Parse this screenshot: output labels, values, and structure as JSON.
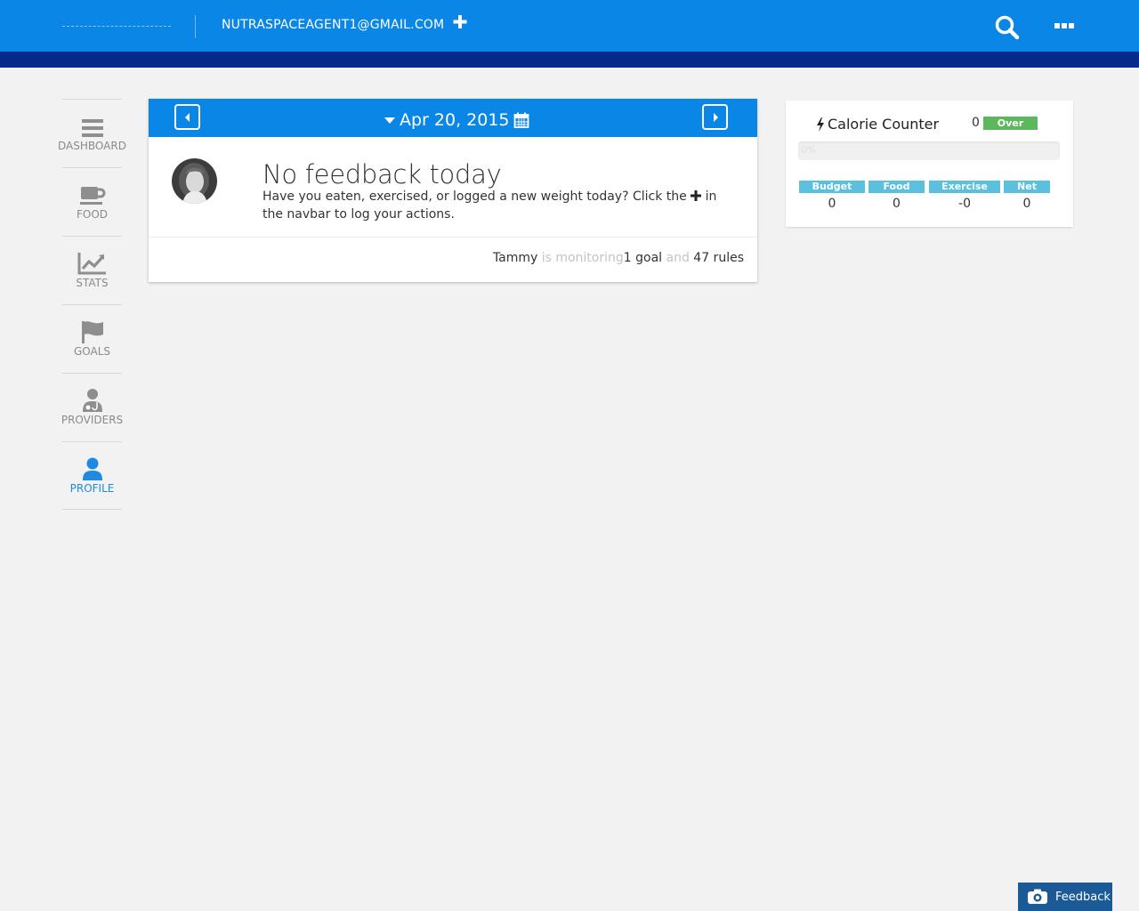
{
  "header": {
    "user_email": "NUTRASPACEAGENT1@GMAIL.COM",
    "add_icon": "plus-icon",
    "search_icon": "search-icon",
    "menu_icon": "ellipsis-icon"
  },
  "sidebar": {
    "items": [
      {
        "label": "DASHBOARD",
        "icon": "bars-icon",
        "active": false
      },
      {
        "label": "FOOD",
        "icon": "coffee-icon",
        "active": false
      },
      {
        "label": "STATS",
        "icon": "line-chart-icon",
        "active": false
      },
      {
        "label": "GOALS",
        "icon": "flag-icon",
        "active": false
      },
      {
        "label": "PROVIDERS",
        "icon": "user-md-icon",
        "active": false
      },
      {
        "label": "PROFILE",
        "icon": "user-icon",
        "active": true
      }
    ]
  },
  "feedback_card": {
    "date": "Apr 20, 2015",
    "title": "No feedback today",
    "text_before": "Have you eaten, exercised, or logged a new weight today? Click the",
    "text_after": "in the navbar to log your actions.",
    "monitor": {
      "name": "Tammy",
      "is_monitoring": "is monitoring",
      "goals": "1 goal",
      "and": "and",
      "rules": "47 rules"
    }
  },
  "calorie_counter": {
    "title": "Calorie Counter",
    "value": "0",
    "badge": "Over",
    "progress_label": "0%",
    "progress_fraction": 0,
    "columns": [
      {
        "label": "Budget",
        "value": "0"
      },
      {
        "label": "Food",
        "value": "0"
      },
      {
        "label": "Exercise",
        "value": "-0"
      },
      {
        "label": "Net",
        "value": "0"
      }
    ]
  },
  "feedback_button": {
    "label": "Feedback"
  },
  "colors": {
    "primary": "#0a86e6",
    "strip": "#062a8c",
    "success": "#5cb85c",
    "info": "#5bc0de",
    "feedback": "#1b5a96"
  }
}
